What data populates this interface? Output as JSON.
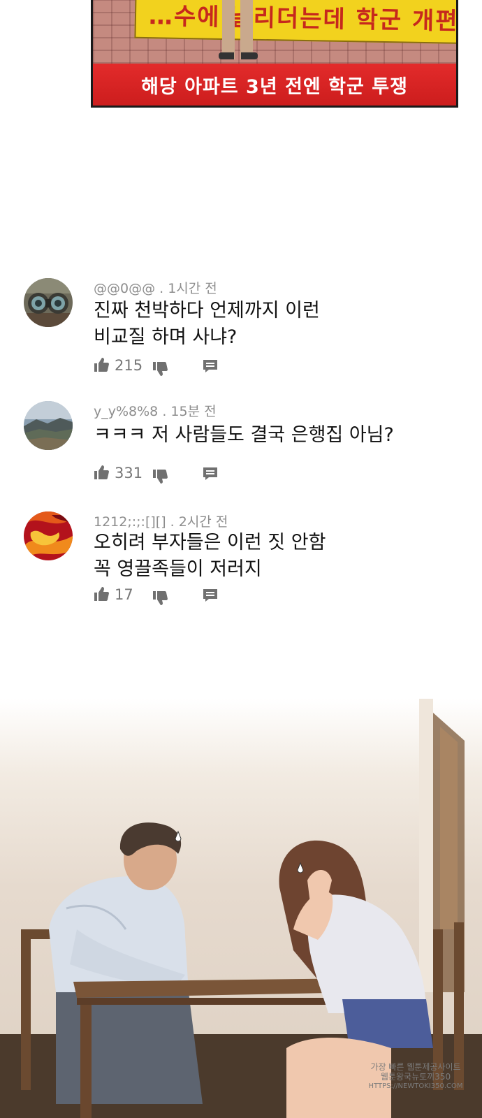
{
  "news_panel": {
    "banner_text": "…수에 날리더는데 학군 개편 웬 말이",
    "caption": "해당 아파트 3년 전엔 학군 투쟁"
  },
  "comments": [
    {
      "author": "@@0@@",
      "separator": " . ",
      "time": "1시간 전",
      "text": "진짜 천박하다 언제까지 이런\n비교질 하며 사냐?",
      "likes": "215",
      "avatar": "binoculars"
    },
    {
      "author": "y_y%8%8",
      "separator": " . ",
      "time": "15분 전",
      "text": "ㅋㅋㅋ 저 사람들도 결국 은행집 아님?",
      "likes": "331",
      "avatar": "landscape"
    },
    {
      "author": "1212;:;:[][]",
      "separator": " . ",
      "time": "2시간 전",
      "text": "오히려 부자들은 이런 짓 안함\n꼭 영끌족들이 저러지",
      "likes": "17",
      "avatar": "abstract-red"
    }
  ],
  "icons": {
    "like": "thumbs-up-icon",
    "dislike": "thumbs-down-icon",
    "reply": "reply-icon"
  },
  "watermark": {
    "line1": "가장 빠른 웹툰제공사이트",
    "line2": "웹툰왕국뉴토끼350",
    "line3": "HTTPS://NEWTOKI350.COM"
  },
  "colors": {
    "caption_red": "#e02828",
    "banner_yellow": "#f2d21e",
    "meta_gray": "#8d8d8d"
  }
}
